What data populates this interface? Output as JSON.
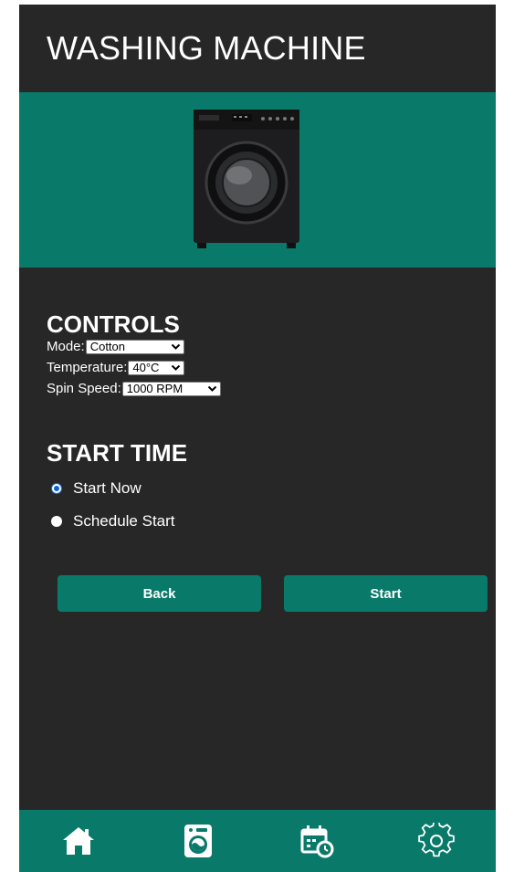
{
  "header": {
    "title": "WASHING MACHINE"
  },
  "hero": {
    "image_icon": "washing-machine-image"
  },
  "controls": {
    "title": "CONTROLS",
    "mode": {
      "label": "Mode:",
      "value": "Cotton"
    },
    "temperature": {
      "label": "Temperature:",
      "value": "40°C"
    },
    "spin_speed": {
      "label": "Spin Speed:",
      "value": "1000 RPM"
    }
  },
  "start_time": {
    "title": "START TIME",
    "options": [
      {
        "label": "Start Now",
        "checked": true
      },
      {
        "label": "Schedule Start",
        "checked": false
      }
    ]
  },
  "buttons": {
    "back": "Back",
    "start": "Start"
  },
  "navbar": {
    "icons": [
      "home-icon",
      "washing-machine-icon",
      "calendar-clock-icon",
      "settings-gear-icon"
    ]
  },
  "colors": {
    "background": "#282728",
    "accent": "#097a69",
    "text": "#ffffff"
  }
}
